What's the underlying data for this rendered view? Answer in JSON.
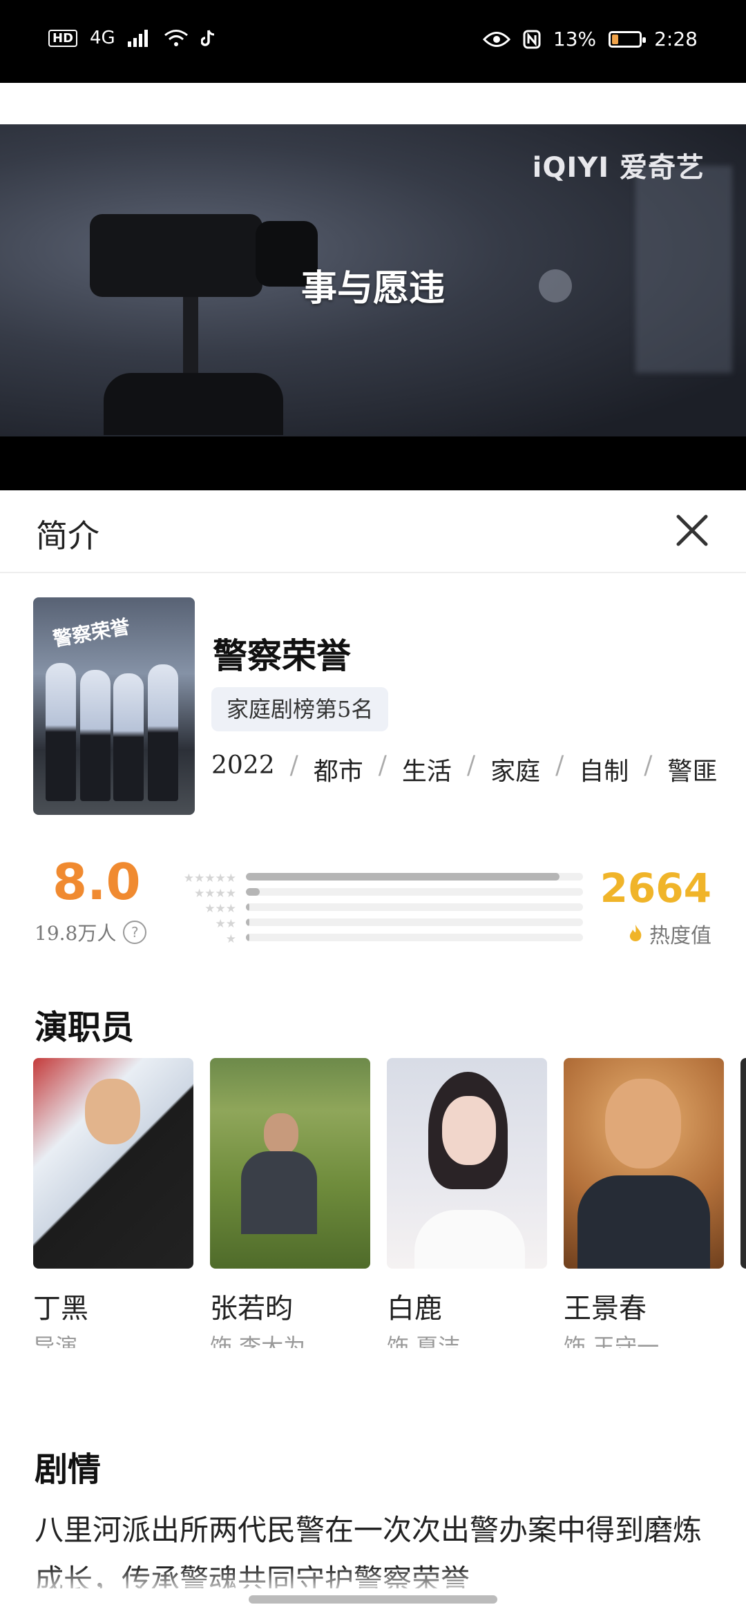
{
  "status_bar": {
    "hd": "HD",
    "network": "4G",
    "battery": "13%",
    "time": "2:28"
  },
  "video": {
    "brand": "iQIYI 爱奇艺",
    "subtitle": "事与愿违"
  },
  "panel": {
    "title": "简介"
  },
  "show": {
    "title": "警察荣誉",
    "rank": "家庭剧榜第5名",
    "tags": [
      "2022",
      "都市",
      "生活",
      "家庭",
      "自制",
      "警匪"
    ],
    "poster_text": "警察荣誉"
  },
  "rating": {
    "score": "8.0",
    "raters": "19.8万人",
    "distribution": [
      0.93,
      0.04,
      0.01,
      0.01,
      0.01
    ],
    "heat_value": "2664",
    "heat_label": "热度值"
  },
  "cast": {
    "title": "演职员",
    "members": [
      {
        "name": "丁黑",
        "role": "导演"
      },
      {
        "name": "张若昀",
        "role": "饰 李大为"
      },
      {
        "name": "白鹿",
        "role": "饰 夏洁"
      },
      {
        "name": "王景春",
        "role": "饰 王守一"
      }
    ]
  },
  "plot": {
    "title": "剧情",
    "text": "八里河派出所两代民警在一次次出警办案中得到磨炼成长，传承警魂共同守护警察荣誉"
  },
  "colors": {
    "score": "#f08a30",
    "heat": "#f0b429",
    "badge_bg": "#eef1f7"
  }
}
